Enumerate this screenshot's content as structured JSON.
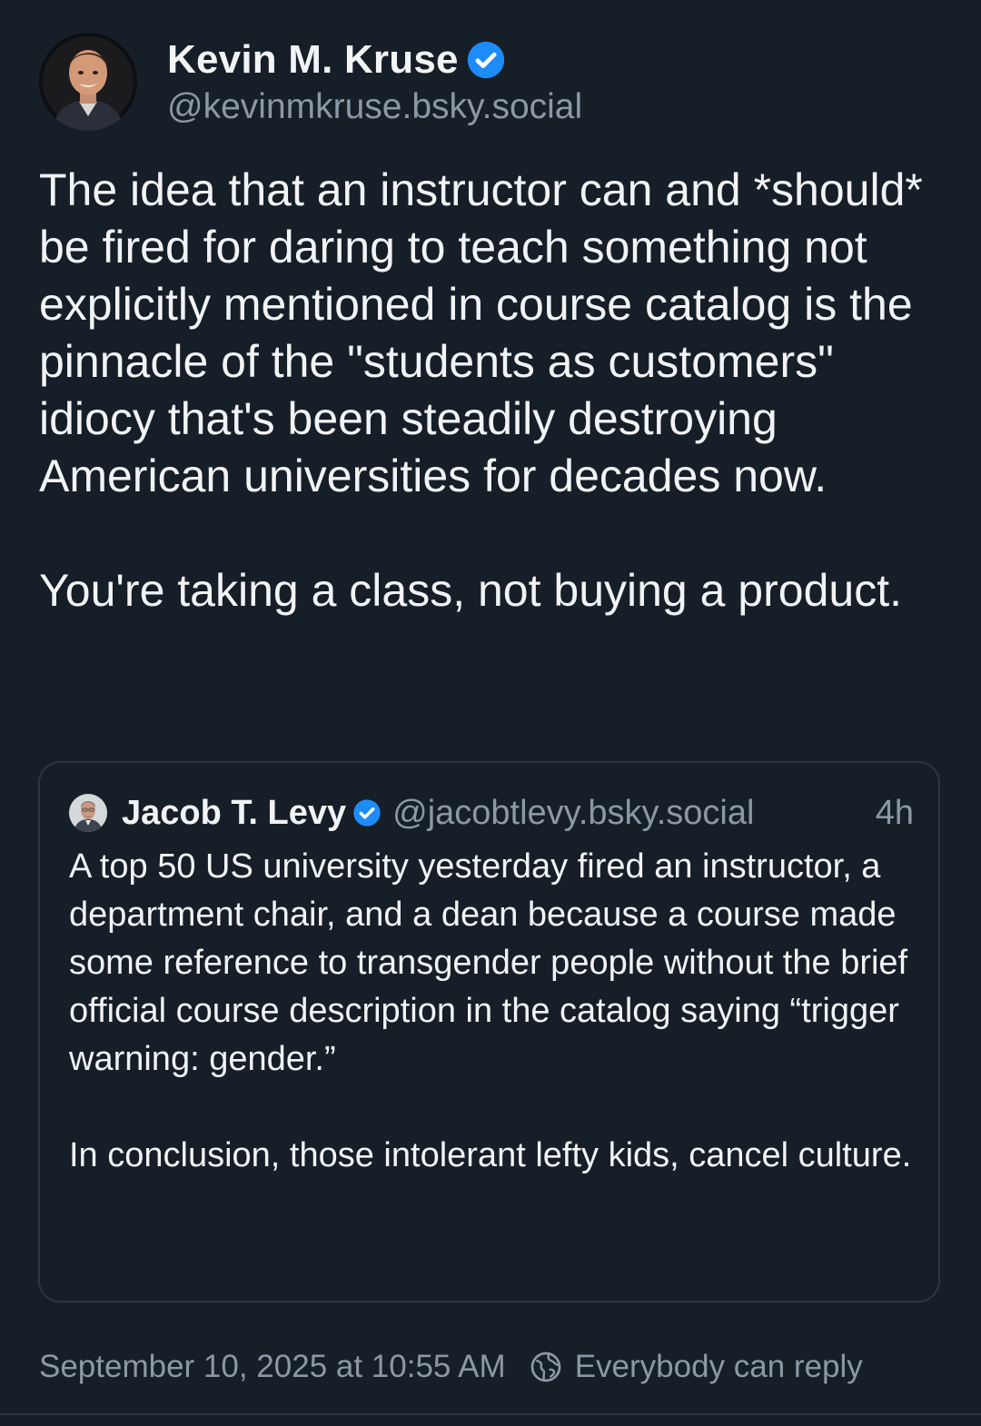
{
  "post": {
    "author": {
      "name": "Kevin M. Kruse",
      "handle": "@kevinmkruse.bsky.social",
      "verified": true
    },
    "text": {
      "paragraph1": "The idea that an instructor can and *should* be fired for daring to teach something not explicitly mentioned in course catalog is the pinnacle of the \"students as customers\" idiocy that's been steadily destroying American universities for decades now.",
      "paragraph2": "You're taking a class, not buying a product."
    },
    "quote": {
      "author": {
        "name": "Jacob T. Levy",
        "handle": "@jacobtlevy.bsky.social",
        "verified": true
      },
      "time": "4h",
      "text": {
        "paragraph1": "A top 50 US university yesterday fired an instructor, a department chair, and a dean because a course made some reference to transgender people without the brief official course description in the catalog saying “trigger warning: gender.”",
        "paragraph2": "In conclusion, those intolerant lefty kids, cancel culture."
      }
    },
    "timestamp": "September 10, 2025 at 10:55 AM",
    "reply_setting": "Everybody can reply",
    "icons": {
      "verified": "verified-check-icon",
      "reply_setting": "globe-icon"
    },
    "colors": {
      "background": "#161e27",
      "verified": "#1d8cf8",
      "muted_text": "#8b98a5",
      "border": "#2b3642"
    }
  }
}
